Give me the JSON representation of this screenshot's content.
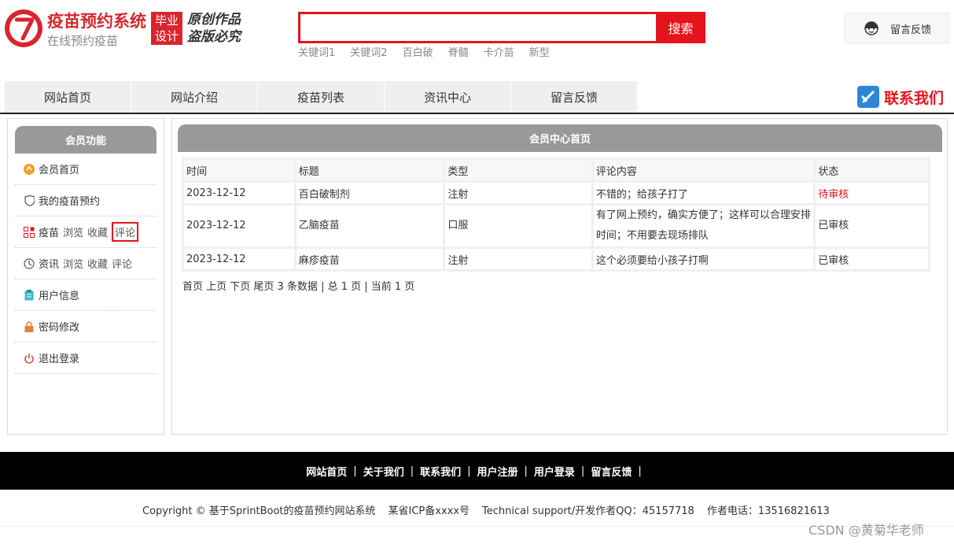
{
  "header": {
    "logo_title": "疫苗预约系统",
    "logo_sub": "在线预约疫苗",
    "grad_badge_line1": "毕业",
    "grad_badge_line2": "设计",
    "orig_line1": "原创作品",
    "orig_line2": "盗版必究",
    "search_placeholder": "",
    "search_button": "搜索",
    "keywords": [
      "关键词1",
      "关键词2",
      "百白破",
      "脊髓",
      "卡介苗",
      "新型"
    ],
    "feedback_label": "留言反馈",
    "contact_label": "联系我们"
  },
  "nav": {
    "items": [
      "网站首页",
      "网站介绍",
      "疫苗列表",
      "资讯中心",
      "留言反馈"
    ]
  },
  "sidebar": {
    "title": "会员功能",
    "items": [
      {
        "label": "会员首页",
        "icon": "home-icon"
      },
      {
        "label": "我的疫苗预约",
        "icon": "shield-icon"
      },
      {
        "label": "疫苗",
        "icon": "apps-icon",
        "subs": [
          "浏览",
          "收藏",
          "评论"
        ]
      },
      {
        "label": "资讯",
        "icon": "history-icon",
        "subs": [
          "浏览",
          "收藏",
          "评论"
        ]
      },
      {
        "label": "用户信息",
        "icon": "clipboard-icon"
      },
      {
        "label": "密码修改",
        "icon": "lock-icon"
      },
      {
        "label": "退出登录",
        "icon": "power-icon"
      }
    ]
  },
  "main": {
    "title": "会员中心首页",
    "columns": [
      "时间",
      "标题",
      "类型",
      "评论内容",
      "状态"
    ],
    "rows": [
      {
        "time": "2023-12-12",
        "title": "百白破制剂",
        "type": "注射",
        "comment": "不错的；给孩子打了",
        "status": "待审核"
      },
      {
        "time": "2023-12-12",
        "title": "乙脑疫苗",
        "type": "口服",
        "comment": "有了网上预约，确实方便了；这样可以合理安排时间；不用要去现场排队",
        "status": "已审核"
      },
      {
        "time": "2023-12-12",
        "title": "麻疹疫苗",
        "type": "注射",
        "comment": "这个必须要给小孩子打啊",
        "status": "已审核"
      }
    ],
    "pager": "首页 上页 下页 尾页 3 条数据 | 总 1 页 | 当前 1 页"
  },
  "footer": {
    "links": [
      "网站首页",
      "关于我们",
      "联系我们",
      "用户注册",
      "用户登录",
      "留言反馈"
    ],
    "separator": "|",
    "copyright": "Copyright © 基于SprintBoot的疫苗预约网站系统",
    "icp": "某省ICP备xxxx号",
    "support": "Technical support/开发作者QQ：45157718",
    "phone": "作者电话：13516821613",
    "watermark": "CSDN @黄菊华老师"
  },
  "colors": {
    "brand_red": "#e5141c",
    "panel_gray": "#999999",
    "footer_black": "#000000"
  }
}
